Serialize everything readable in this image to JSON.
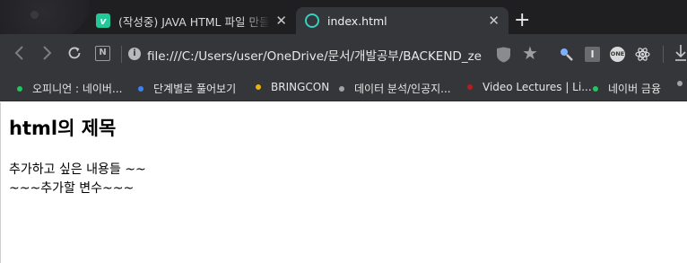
{
  "tabs": [
    {
      "title": "(작성중) JAVA HTML 파일 만들기",
      "favicon": "v-icon",
      "active": false
    },
    {
      "title": "index.html",
      "favicon": "globe-icon",
      "active": true
    }
  ],
  "tab_close_glyph": "✕",
  "new_tab_glyph": "+",
  "toolbar": {
    "url": "file:///C:/Users/user/OneDrive/문서/개발공부/BACKEND_ze",
    "reader_label": "N",
    "info_glyph": "i",
    "ext_i_label": "I",
    "ext_one_label": "ONE"
  },
  "bookmarks": [
    {
      "label": "오피니언 : 네이버...",
      "color": "#22c55e"
    },
    {
      "label": "단계별로 풀어보기",
      "color": "#3b82f6"
    },
    {
      "label": "BRINGCON",
      "color": "#eab308"
    },
    {
      "label": "데이터 분석/인공지...",
      "color": "#a3a3a3"
    },
    {
      "label": "Video Lectures | Li...",
      "color": "#b91c1c"
    },
    {
      "label": "네이버 금융",
      "color": "#22c55e"
    }
  ],
  "page": {
    "heading": "html의 제목",
    "line1": "추가하고 싶은 내용들 ~~",
    "line2": "~~~추가할 변수~~~"
  }
}
